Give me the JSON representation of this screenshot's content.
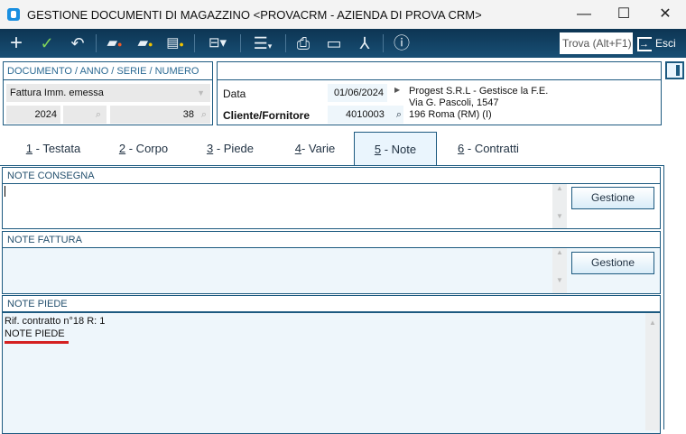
{
  "window": {
    "title": "GESTIONE DOCUMENTI DI MAGAZZINO <PROVACRM - AZIENDA DI PROVA CRM>",
    "minimize": "—",
    "maximize": "☐",
    "close": "✕"
  },
  "toolbar": {
    "search_placeholder": "Trova (Alt+F1)",
    "exit_label": "Esci"
  },
  "document": {
    "header": "DOCUMENTO / ANNO / SERIE / NUMERO",
    "type": "Fattura Imm. emessa",
    "year": "2024",
    "series": "",
    "number": "38"
  },
  "header": {
    "date_label": "Data",
    "date": "01/06/2024",
    "customer_label": "Cliente/Fornitore",
    "customer_code": "4010003",
    "customer_name": "Progest S.R.L  - Gestisce la F.E.",
    "customer_address": "Via G. Pascoli, 1547",
    "customer_city": "196 Roma (RM)   (I)"
  },
  "tabs": [
    {
      "key": "1",
      "label": " - Testata"
    },
    {
      "key": "2",
      "label": " - Corpo"
    },
    {
      "key": "3",
      "label": " - Piede"
    },
    {
      "key": "4",
      "label": "- Varie"
    },
    {
      "key": "5",
      "label": " - Note"
    },
    {
      "key": "6",
      "label": " - Contratti"
    }
  ],
  "notes": {
    "consegna_label": "NOTE CONSEGNA",
    "consegna_value": "",
    "fattura_label": "NOTE FATTURA",
    "fattura_value": "",
    "piede_label": "NOTE PIEDE",
    "piede_line1": "Rif. contratto n°18 R: 1",
    "piede_line2": "NOTE PIEDE",
    "gestione_label": "Gestione"
  }
}
